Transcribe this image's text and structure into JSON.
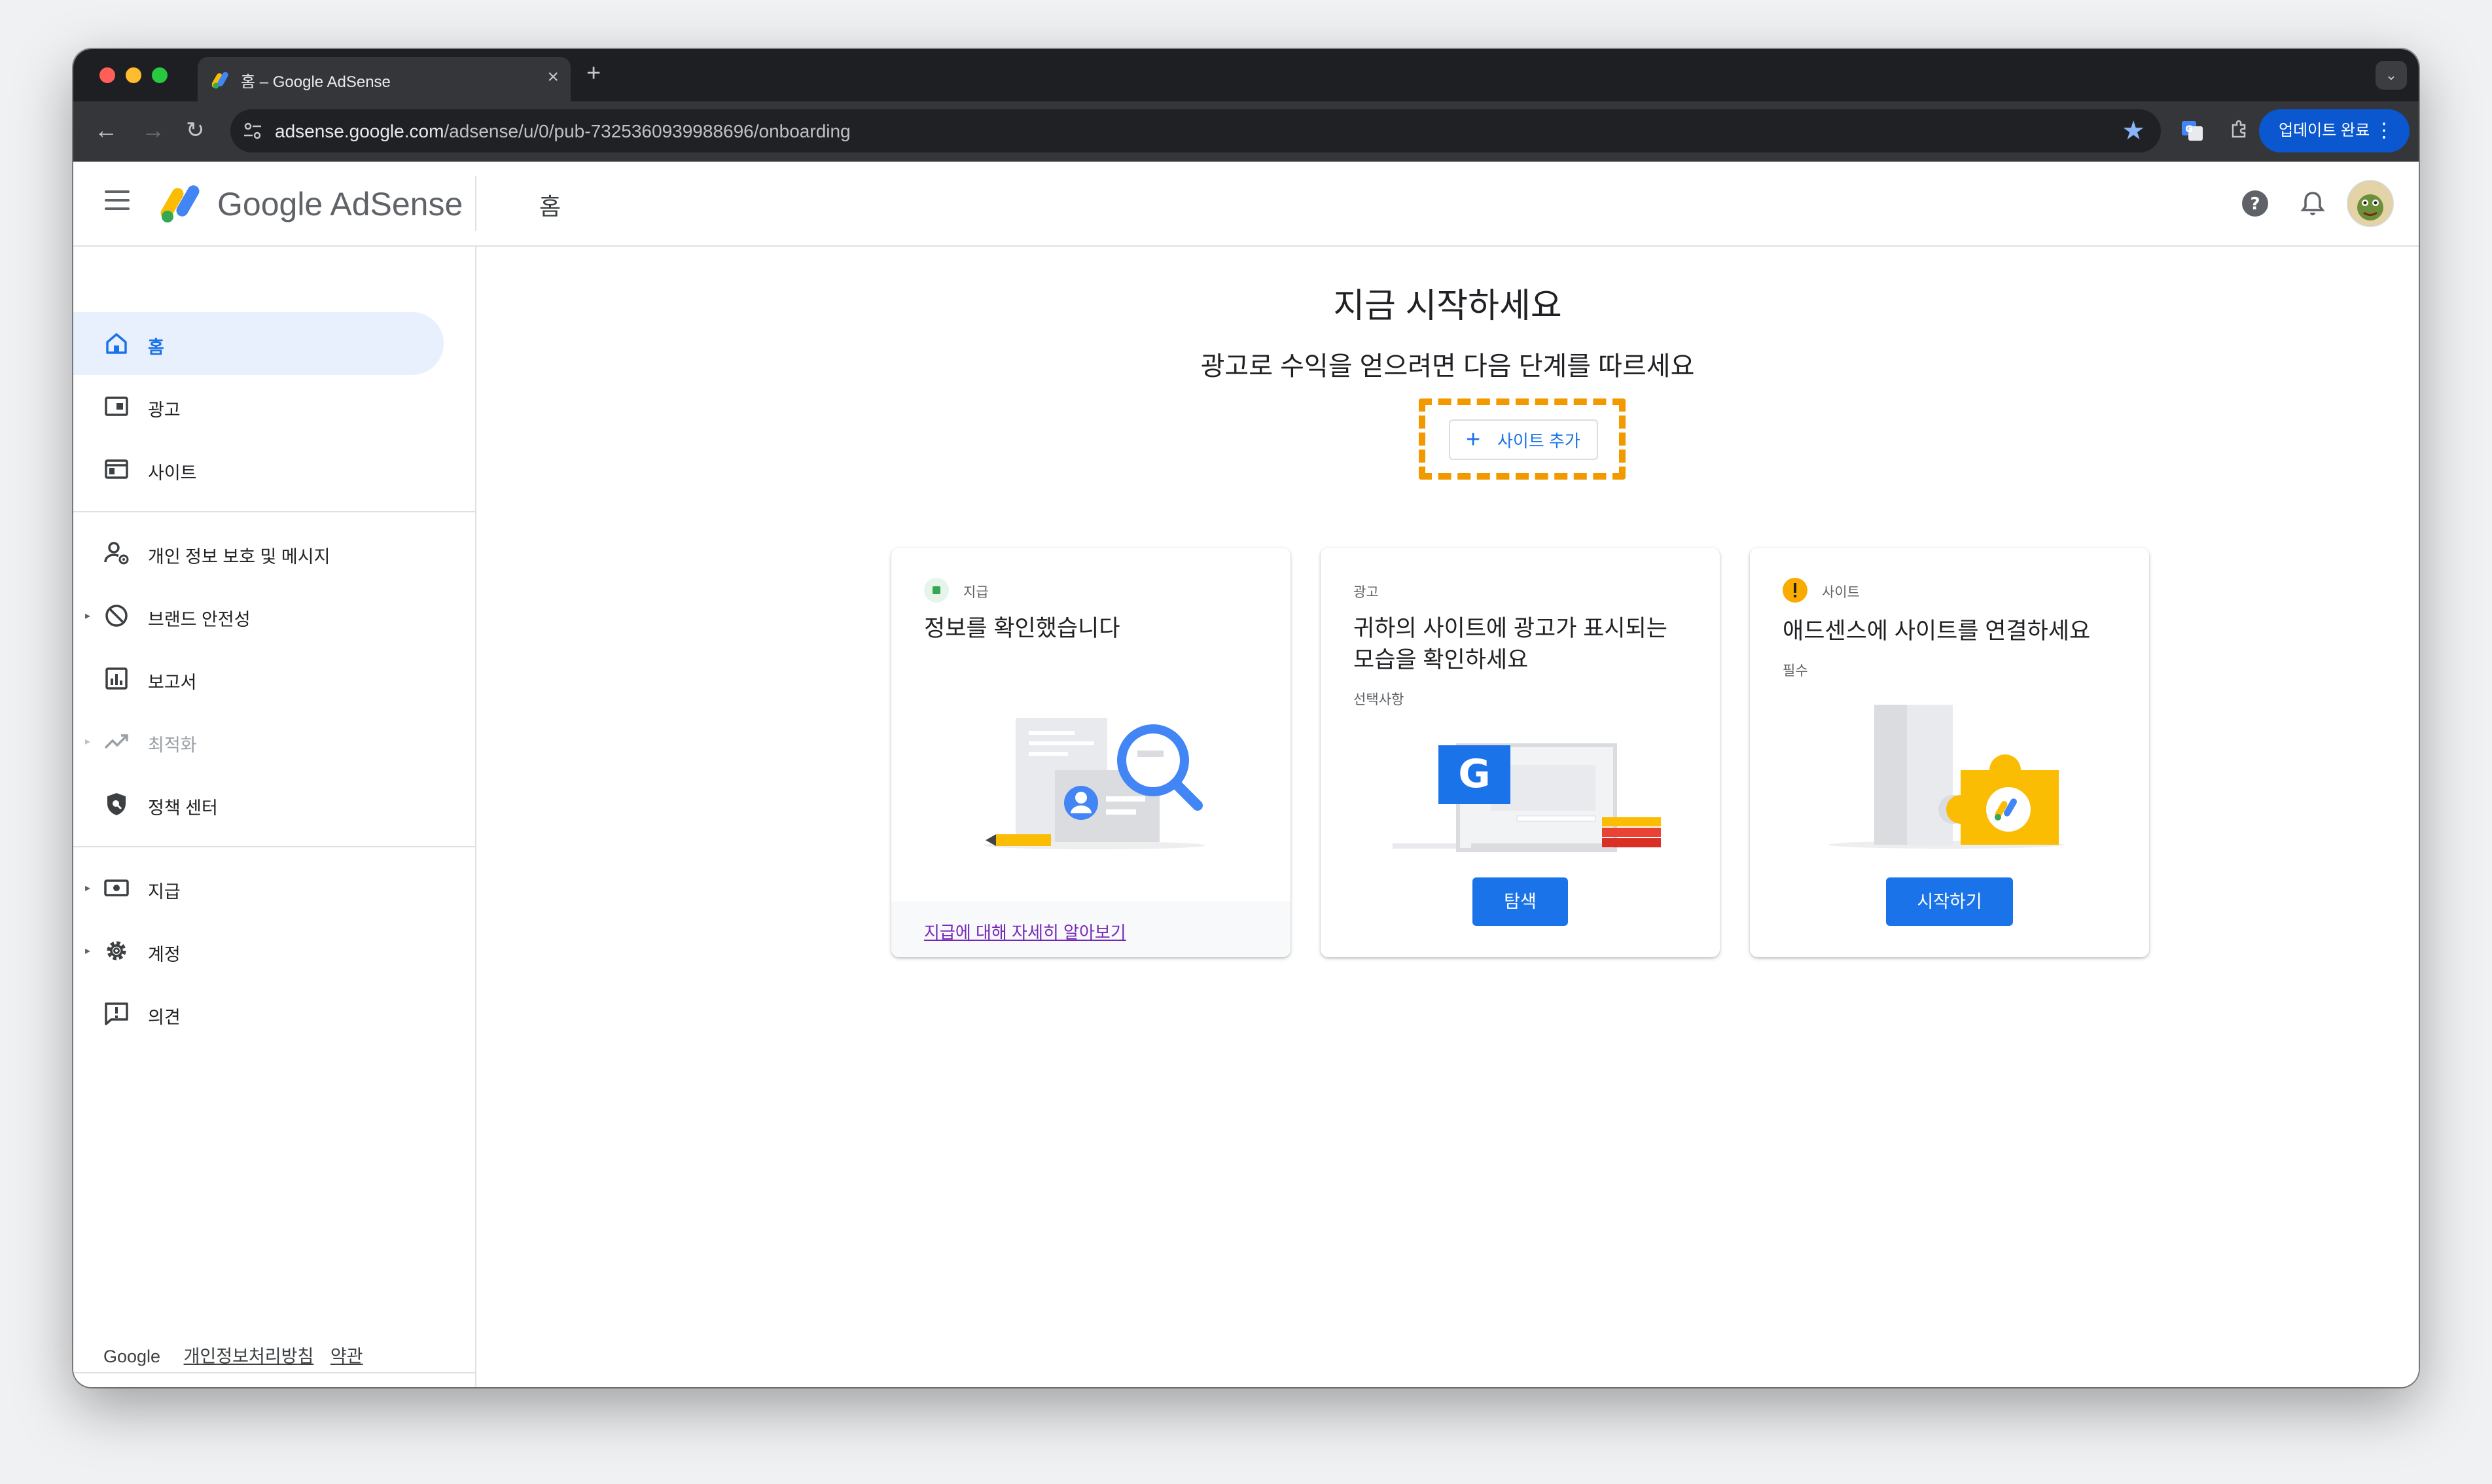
{
  "browser": {
    "tab_title": "홈 – Google AdSense",
    "url_host": "adsense.google.com",
    "url_path": "/adsense/u/0/pub-7325360939988696/onboarding",
    "update_button": "업데이트 완료"
  },
  "header": {
    "brand": "Google AdSense",
    "page_title": "홈"
  },
  "sidebar": {
    "items": [
      {
        "label": "홈"
      },
      {
        "label": "광고"
      },
      {
        "label": "사이트"
      },
      {
        "label": "개인 정보 보호 및 메시지"
      },
      {
        "label": "브랜드 안전성"
      },
      {
        "label": "보고서"
      },
      {
        "label": "최적화"
      },
      {
        "label": "정책 센터"
      },
      {
        "label": "지급"
      },
      {
        "label": "계정"
      },
      {
        "label": "의견"
      }
    ],
    "footer": {
      "brand": "Google",
      "privacy": "개인정보처리방침",
      "terms": "약관"
    }
  },
  "main": {
    "title": "지금 시작하세요",
    "subtitle": "광고로 수익을 얻으려면 다음 단계를 따르세요",
    "add_site_button": "사이트 추가",
    "cards": [
      {
        "kicker": "지급",
        "title": "정보를 확인했습니다",
        "link": "지급에 대해 자세히 알아보기"
      },
      {
        "kicker": "광고",
        "title": "귀하의 사이트에 광고가 표시되는 모습을 확인하세요",
        "meta": "선택사항",
        "button": "탐색"
      },
      {
        "kicker": "사이트",
        "title": "애드센스에 사이트를 연결하세요",
        "meta": "필수",
        "button": "시작하기"
      }
    ]
  },
  "colors": {
    "accent": "#1a73e8",
    "highlight_dash": "#f29900",
    "done_status": "#34a853",
    "warning_status": "#f9ab00"
  }
}
